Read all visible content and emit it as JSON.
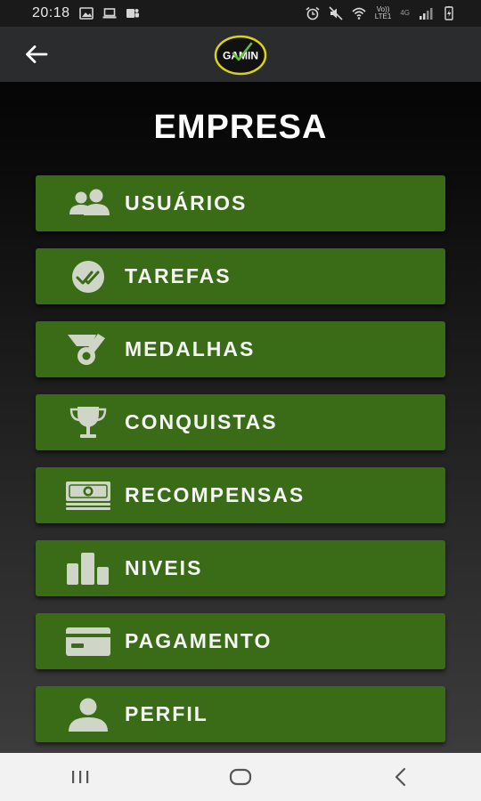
{
  "status_bar": {
    "time": "20:18",
    "volte_top": "Vo))",
    "volte_bottom": "LTE1",
    "network": "4G"
  },
  "app_bar": {
    "back_icon": "arrow-left-icon",
    "logo_text": "GAMIN"
  },
  "page": {
    "title": "EMPRESA"
  },
  "menu": {
    "items": [
      {
        "label": "USUÁRIOS",
        "icon": "users-icon"
      },
      {
        "label": "TAREFAS",
        "icon": "check-tasks-icon"
      },
      {
        "label": "MEDALHAS",
        "icon": "medal-icon"
      },
      {
        "label": "CONQUISTAS",
        "icon": "trophy-icon"
      },
      {
        "label": "RECOMPENSAS",
        "icon": "money-icon"
      },
      {
        "label": "NIVEIS",
        "icon": "levels-icon"
      },
      {
        "label": "PAGAMENTO",
        "icon": "credit-card-icon"
      },
      {
        "label": "PERFIL",
        "icon": "user-icon"
      }
    ]
  },
  "colors": {
    "button_green": "#3a6b16",
    "icon_gray": "#cfd6c8",
    "app_bar": "#2b2c2e",
    "logo_yellow": "#d9d21c"
  }
}
